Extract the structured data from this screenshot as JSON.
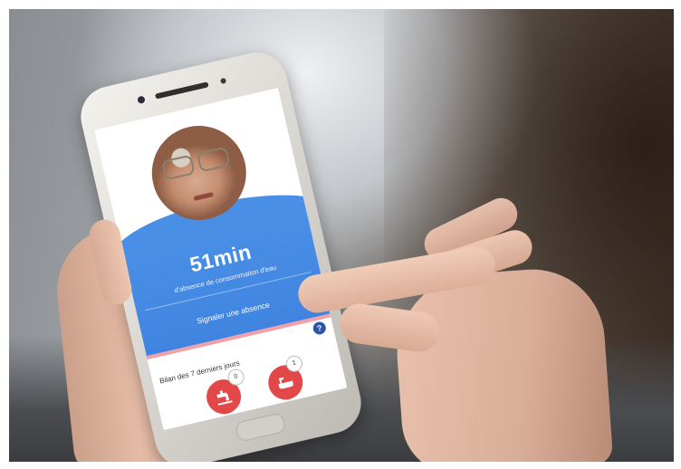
{
  "app": {
    "timer_value": "51min",
    "timer_caption": "d'absence de consommation d'eau",
    "report_button": "Signaler une absence",
    "help_glyph": "?",
    "summary_title": "Bilan des 7 derniers jours",
    "stats": [
      {
        "icon": "faucet-icon",
        "count": "0"
      },
      {
        "icon": "bathtub-icon",
        "count": "1"
      }
    ]
  },
  "colors": {
    "accent_blue": "#4a8fe6",
    "alert_red": "#e34848",
    "divider_pink": "#f2a1a8",
    "help_navy": "#2b55a8"
  }
}
